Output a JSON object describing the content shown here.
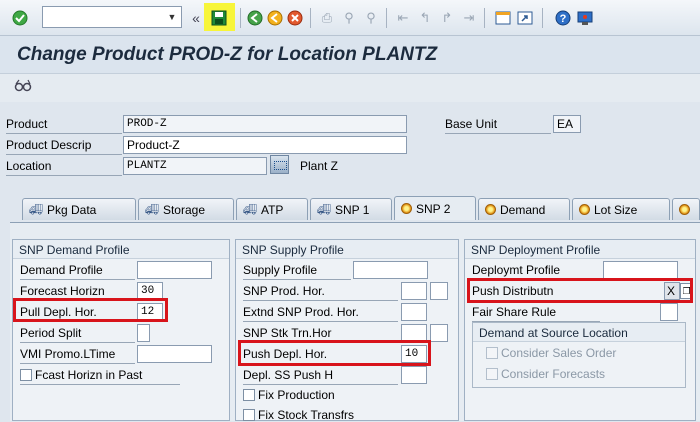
{
  "toolbar": {
    "command_value": "",
    "icons": [
      "enter-icon",
      "save-icon",
      "back-icon",
      "exit-icon",
      "cancel-icon",
      "print-icon",
      "find-icon",
      "find-next-icon",
      "first-page-icon",
      "previous-page-icon",
      "next-page-icon",
      "last-page-icon",
      "create-session-icon",
      "shortcut-icon",
      "help-icon",
      "customize-layout-icon"
    ],
    "save_highlight_color": "#f7f53a"
  },
  "header": {
    "title": "Change Product PROD-Z for Location PLANTZ"
  },
  "form": {
    "product_label": "Product",
    "product_value": "PROD-Z",
    "descrip_label": "Product Descrip",
    "descrip_value": "Product-Z",
    "location_label": "Location",
    "location_value": "PLANTZ",
    "location_desc": "Plant Z",
    "base_unit_label": "Base Unit",
    "base_unit_value": "EA"
  },
  "tabs": [
    {
      "label": "Pkg Data",
      "icon": "truck-icon"
    },
    {
      "label": "Storage",
      "icon": "truck-icon"
    },
    {
      "label": "ATP",
      "icon": "truck-icon"
    },
    {
      "label": "SNP 1",
      "icon": "truck-icon"
    },
    {
      "label": "SNP 2",
      "icon": "bulb-icon",
      "active": true
    },
    {
      "label": "Demand",
      "icon": "bulb-icon"
    },
    {
      "label": "Lot Size",
      "icon": "bulb-icon"
    },
    {
      "label": "",
      "icon": "bulb-icon"
    }
  ],
  "snp_demand": {
    "title": "SNP Demand Profile",
    "demand_profile_label": "Demand Profile",
    "demand_profile_value": "",
    "forecast_horizn_label": "Forecast Horizn",
    "forecast_horizn_value": "30",
    "pull_depl_label": "Pull Depl. Hor.",
    "pull_depl_value": "12",
    "period_split_label": "Period Split",
    "vmi_label": "VMI Promo.LTime",
    "fcast_label": "Fcast Horizn in Past"
  },
  "snp_supply": {
    "title": "SNP Supply Profile",
    "supply_profile_label": "Supply Profile",
    "snp_prod_hor_label": "SNP Prod. Hor.",
    "extnd_label": "Extnd SNP Prod. Hor.",
    "stk_trn_label": "SNP Stk Trn.Hor",
    "push_depl_label": "Push Depl. Hor.",
    "push_depl_value": "10",
    "depl_ss_label": "Depl. SS Push H",
    "fix_production_label": "Fix Production",
    "fix_stock_label": "Fix Stock Transfrs"
  },
  "snp_deploy": {
    "title": "SNP Deployment Profile",
    "deploymt_label": "Deploymt Profile",
    "push_distrib_label": "Push Distributn",
    "push_distrib_value": "X",
    "fair_share_label": "Fair Share Rule",
    "demand_source_title": "Demand at Source Location",
    "consider_sales_label": "Consider Sales Order",
    "consider_forecasts_label": "Consider Forecasts"
  },
  "highlight_color": "#d8141b"
}
